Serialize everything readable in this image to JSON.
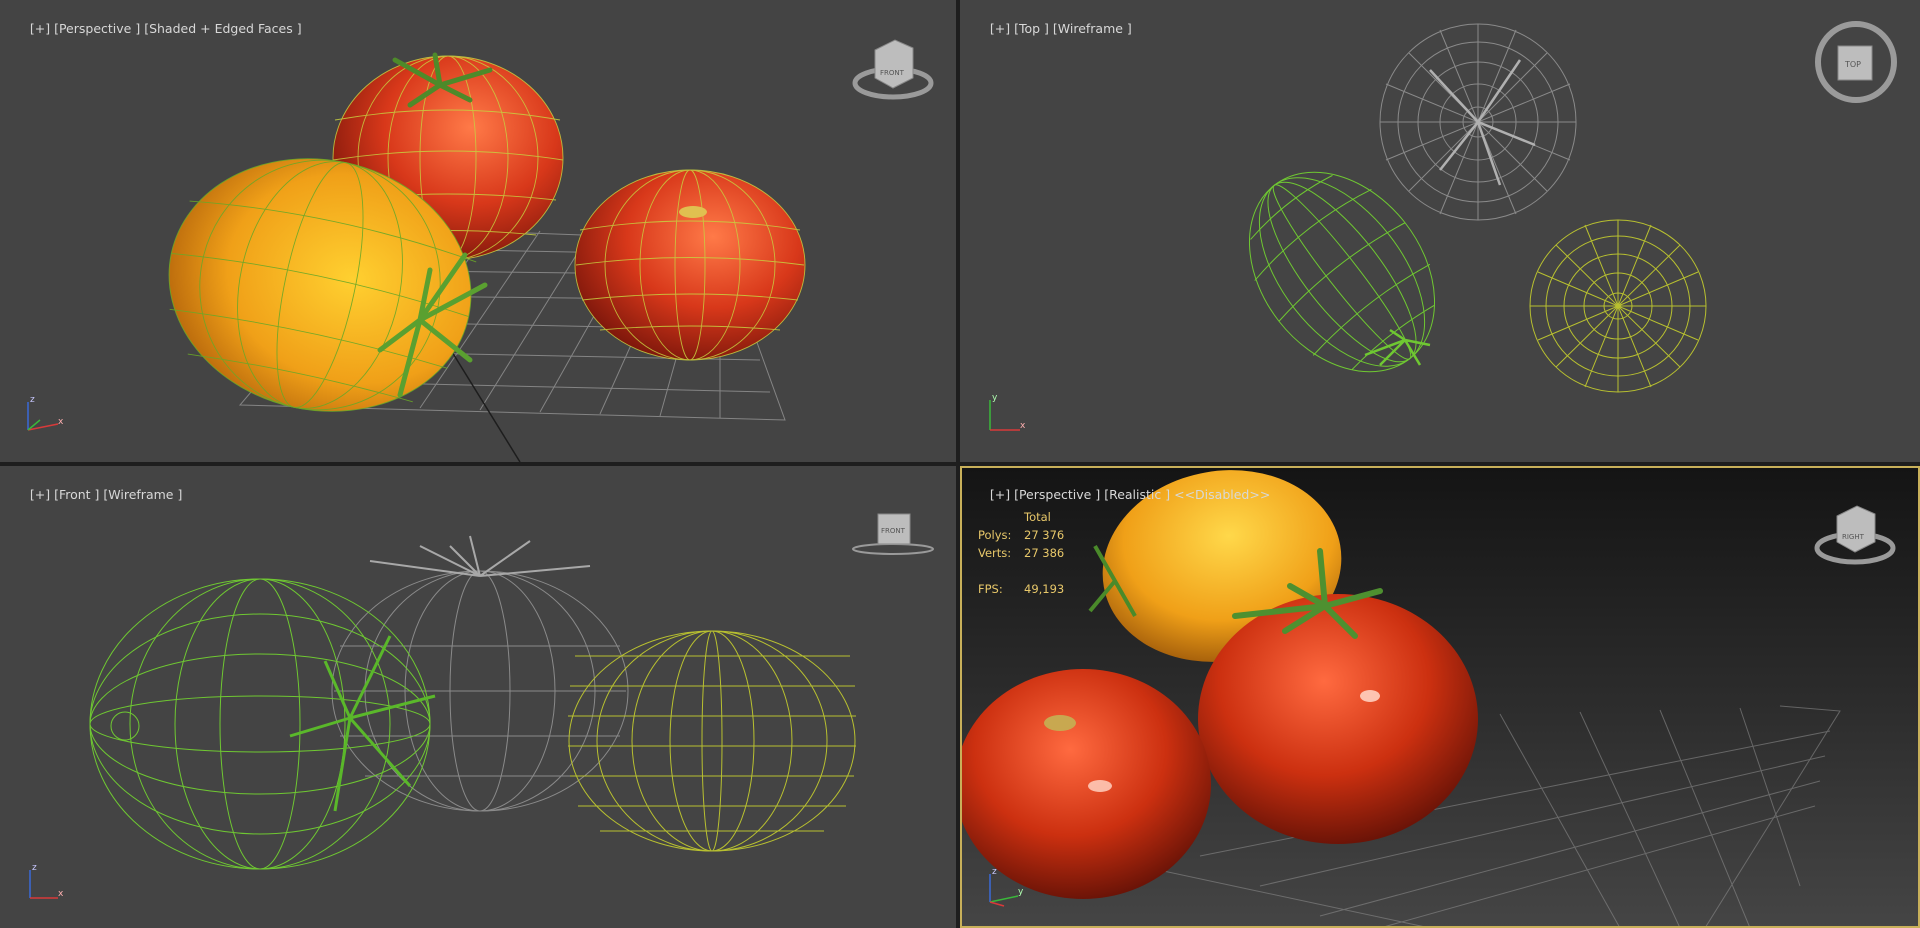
{
  "viewports": [
    {
      "id": "perspective-shaded",
      "labels": [
        "[+]",
        "[Perspective ]",
        "[Shaded + Edged Faces ]"
      ],
      "viewcube": "FRONT"
    },
    {
      "id": "top-wireframe",
      "labels": [
        "[+]",
        "[Top ]",
        "[Wireframe ]"
      ],
      "viewcube": "TOP"
    },
    {
      "id": "front-wireframe",
      "labels": [
        "[+]",
        "[Front ]",
        "[Wireframe ]"
      ],
      "viewcube": "FRONT"
    },
    {
      "id": "perspective-realistic",
      "labels": [
        "[+]",
        "[Perspective ]",
        "[Realistic ]",
        "<<Disabled>>"
      ],
      "viewcube": "RIGHT",
      "active": true
    }
  ],
  "stats": {
    "header": "Total",
    "polys_label": "Polys:",
    "polys_value": "27 376",
    "verts_label": "Verts:",
    "verts_value": "27 386",
    "fps_label": "FPS:",
    "fps_value": "49,193"
  },
  "axis": {
    "x": "x",
    "y": "y",
    "z": "z"
  },
  "colors": {
    "viewport_bg": "#444444",
    "active_border": "#c8b05a",
    "wire_green": "#6fc832",
    "wire_yellow": "#b8c030",
    "wire_gray": "#8a8a8a",
    "tomato_red": "#d8381a",
    "tomato_yellow": "#f0a018",
    "stats_text": "#e8c86a"
  },
  "icons": [
    "viewcube-icon",
    "axis-tripod-icon",
    "tomato-stem-icon"
  ]
}
